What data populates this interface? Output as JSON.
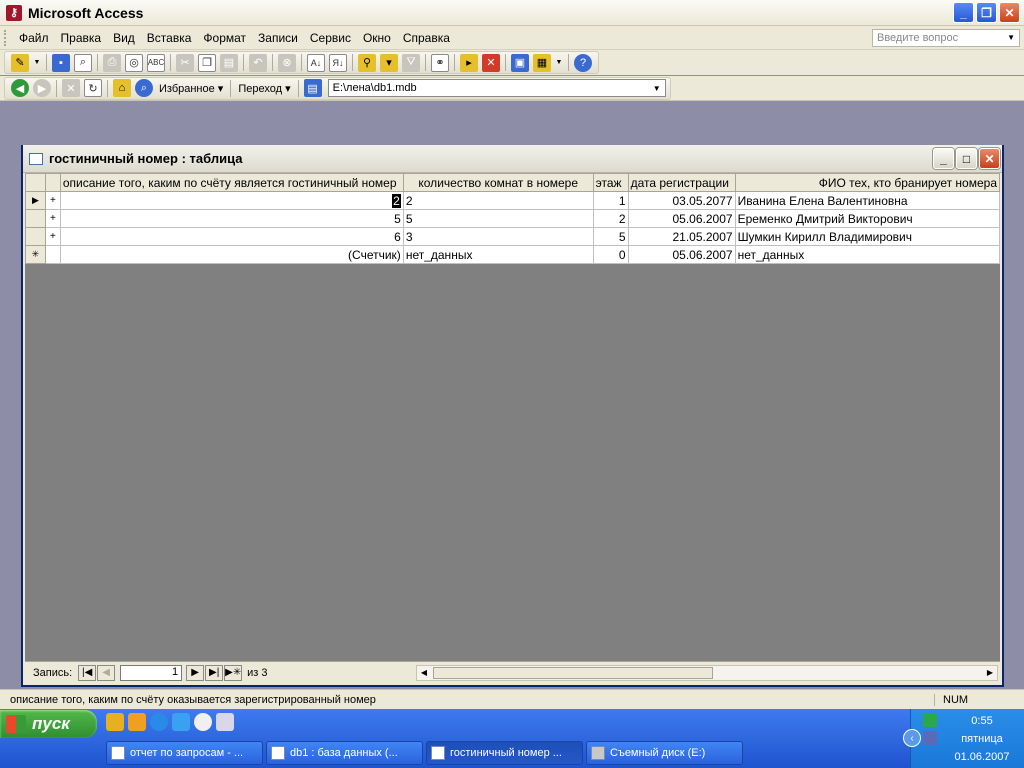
{
  "app": {
    "title": "Microsoft Access"
  },
  "menu": {
    "items": [
      "Файл",
      "Правка",
      "Вид",
      "Вставка",
      "Формат",
      "Записи",
      "Сервис",
      "Окно",
      "Справка"
    ],
    "help_placeholder": "Введите вопрос"
  },
  "web_toolbar": {
    "favorites_label": "Избранное",
    "goto_label": "Переход",
    "path_value": "E:\\лена\\db1.mdb"
  },
  "table_window": {
    "title": "гостиничный номер : таблица",
    "columns": [
      "описание того, каким по счёту является гостиничный номер",
      "количество комнат в номере",
      "этаж",
      "дата регистрации",
      "ФИО тех, кто бранирует номера"
    ],
    "rows": [
      {
        "marker": "▶",
        "expand": "+",
        "c1": "2",
        "c2": "2",
        "c3": "1",
        "c4": "03.05.2077",
        "c5": "Иванина Елена Валентиновна"
      },
      {
        "marker": "",
        "expand": "+",
        "c1": "5",
        "c2": "5",
        "c3": "2",
        "c4": "05.06.2007",
        "c5": "Еременко Дмитрий Викторович"
      },
      {
        "marker": "",
        "expand": "+",
        "c1": "6",
        "c2": "3",
        "c3": "5",
        "c4": "21.05.2007",
        "c5": "Шумкин Кирилл Владимирович"
      },
      {
        "marker": "✳",
        "expand": "",
        "c1": "(Счетчик)",
        "c2": "нет_данных",
        "c3": "0",
        "c4": "05.06.2007",
        "c5": "нет_данных"
      }
    ],
    "nav": {
      "label": "Запись:",
      "current": "1",
      "of_label": "из",
      "total": "3"
    }
  },
  "status_bar": {
    "text": "описание того, каким по счёту оказывается зарегистрированный номер",
    "num": "NUM"
  },
  "taskbar": {
    "start_label": "пуск",
    "tasks": [
      "отчет по запросам - ...",
      "db1 : база данных (...",
      "гостиничный номер ...",
      "Съемный диск (E:)"
    ],
    "clock_time": "0:55",
    "clock_day": "пятница",
    "clock_date": "01.06.2007"
  }
}
